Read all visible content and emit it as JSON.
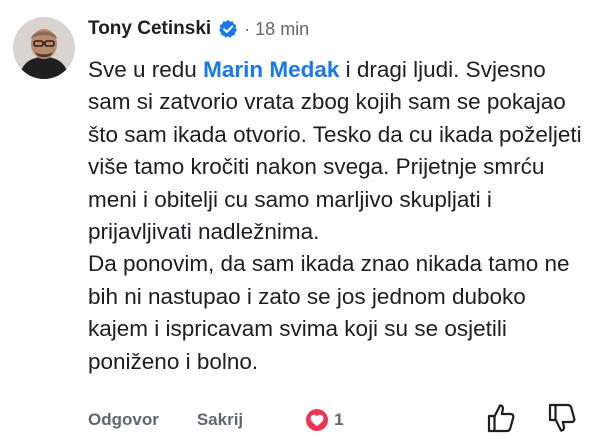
{
  "comment": {
    "author": "Tony Cetinski",
    "time": "· 18 min",
    "mention": "Marin Medak",
    "text_before_mention": "Sve u redu ",
    "text_after_mention": " i dragi ljudi. Svjesno sam si zatvorio vrata zbog kojih sam se pokajao što sam ikada otvorio. Tesko da cu ikada poželjeti više tamo kročiti nakon svega. Prijetnje smrću meni i obitelji cu samo marljivo skupljati i prijavljivati nadležnima.",
    "second_paragraph": "Da ponovim, da sam ikada znao nikada tamo ne bih ni nastupao i zato se jos jednom duboko kajem i ispricavam svima koji su se osjetili poniženo i bolno."
  },
  "actions": {
    "reply_label": "Odgovor",
    "hide_label": "Sakrij",
    "reaction_count": "1"
  },
  "icons": {
    "avatar": "profile-photo",
    "verified": "verified-badge-icon",
    "reaction": "heart-icon",
    "upvote": "thumbs-up-icon",
    "downvote": "thumbs-down-icon"
  },
  "colors": {
    "mention": "#1877f2",
    "verified_badge": "#1877f2",
    "heart": "#f03355",
    "meta_text": "#65676b",
    "action_text": "#606770"
  }
}
